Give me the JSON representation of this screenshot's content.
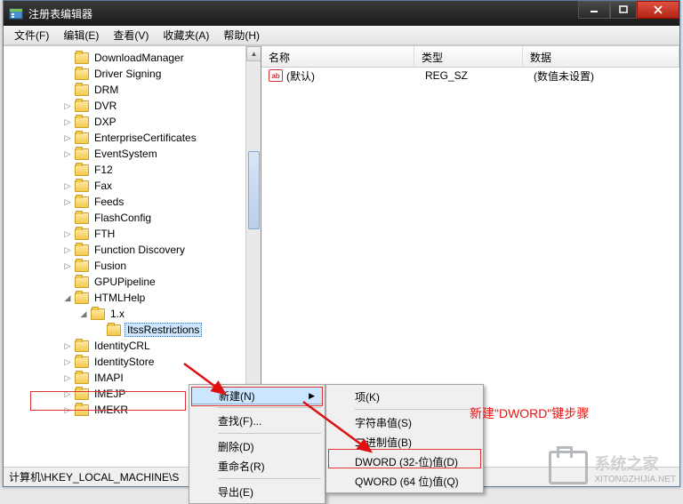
{
  "window": {
    "title": "注册表编辑器"
  },
  "menu": {
    "file": "文件(F)",
    "edit": "编辑(E)",
    "view": "查看(V)",
    "fav": "收藏夹(A)",
    "help": "帮助(H)"
  },
  "tree": {
    "items": [
      {
        "l": "DownloadManager",
        "i": 3,
        "t": ""
      },
      {
        "l": "Driver Signing",
        "i": 3,
        "t": ""
      },
      {
        "l": "DRM",
        "i": 3,
        "t": ""
      },
      {
        "l": "DVR",
        "i": 3,
        "t": "▷"
      },
      {
        "l": "DXP",
        "i": 3,
        "t": "▷"
      },
      {
        "l": "EnterpriseCertificates",
        "i": 3,
        "t": "▷"
      },
      {
        "l": "EventSystem",
        "i": 3,
        "t": "▷"
      },
      {
        "l": "F12",
        "i": 3,
        "t": ""
      },
      {
        "l": "Fax",
        "i": 3,
        "t": "▷"
      },
      {
        "l": "Feeds",
        "i": 3,
        "t": "▷"
      },
      {
        "l": "FlashConfig",
        "i": 3,
        "t": ""
      },
      {
        "l": "FTH",
        "i": 3,
        "t": "▷"
      },
      {
        "l": "Function Discovery",
        "i": 3,
        "t": "▷"
      },
      {
        "l": "Fusion",
        "i": 3,
        "t": "▷"
      },
      {
        "l": "GPUPipeline",
        "i": 3,
        "t": ""
      },
      {
        "l": "HTMLHelp",
        "i": 3,
        "t": "▲"
      },
      {
        "l": "1.x",
        "i": 4,
        "t": "▲"
      },
      {
        "l": "ItssRestrictions",
        "i": 5,
        "t": "",
        "sel": true
      },
      {
        "l": "IdentityCRL",
        "i": 3,
        "t": "▷"
      },
      {
        "l": "IdentityStore",
        "i": 3,
        "t": "▷"
      },
      {
        "l": "IMAPI",
        "i": 3,
        "t": "▷"
      },
      {
        "l": "IMEJP",
        "i": 3,
        "t": "▷"
      },
      {
        "l": "IMEKR",
        "i": 3,
        "t": "▷"
      }
    ]
  },
  "list": {
    "cols": {
      "name": "名称",
      "type": "类型",
      "data": "数据"
    },
    "rows": [
      {
        "icon": "ab",
        "name": "(默认)",
        "type": "REG_SZ",
        "data": "(数值未设置)"
      }
    ]
  },
  "ctx1": {
    "new": "新建(N)",
    "find": "查找(F)...",
    "del": "删除(D)",
    "ren": "重命名(R)",
    "exp": "导出(E)"
  },
  "ctx2": {
    "key": "项(K)",
    "str": "字符串值(S)",
    "bin": "二进制值(B)",
    "dword": "DWORD (32-位)值(D)",
    "qword": "QWORD (64 位)值(Q)"
  },
  "status": {
    "path": "计算机\\HKEY_LOCAL_MACHINE\\S"
  },
  "annotation": {
    "text": "新建\"DWORD\"键步骤"
  },
  "watermark": {
    "brand": "系统之家",
    "url": "XITONGZHIJIA.NET"
  },
  "colors": {
    "red": "#e04030"
  }
}
